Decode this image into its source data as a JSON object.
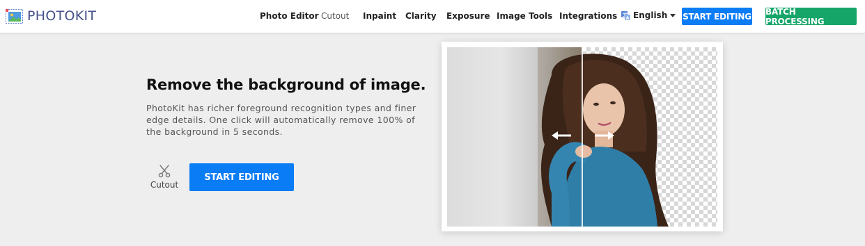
{
  "brand": {
    "name": "PHOTOKIT"
  },
  "nav": {
    "items": [
      {
        "label": "Photo Editor",
        "active": false
      },
      {
        "label": "Cutout",
        "active": true
      },
      {
        "label": "Inpaint",
        "active": false
      },
      {
        "label": "Clarity",
        "active": false
      },
      {
        "label": "Exposure",
        "active": false
      },
      {
        "label": "Image Tools",
        "active": false
      },
      {
        "label": "Integrations",
        "active": false
      }
    ],
    "language": "English",
    "start_editing": "START EDITING",
    "batch_processing": "BATCH PROCESSING"
  },
  "hero": {
    "title": "Remove the background of image.",
    "description": "PhotoKit has richer foreground recognition types and finer edge details. One click will automatically remove 100% of the background in 5 seconds.",
    "tool_label": "Cutout",
    "cta": "START EDITING"
  },
  "colors": {
    "primary_blue": "#0a7cf6",
    "batch_green": "#16a569",
    "logo_text": "#45508c",
    "background": "#eeeeee"
  },
  "icons": {
    "logo": "photokit-logo-icon",
    "language": "translate-icon",
    "tool": "scissors-icon",
    "arrows": [
      "arrow-left-icon",
      "arrow-right-icon"
    ]
  }
}
